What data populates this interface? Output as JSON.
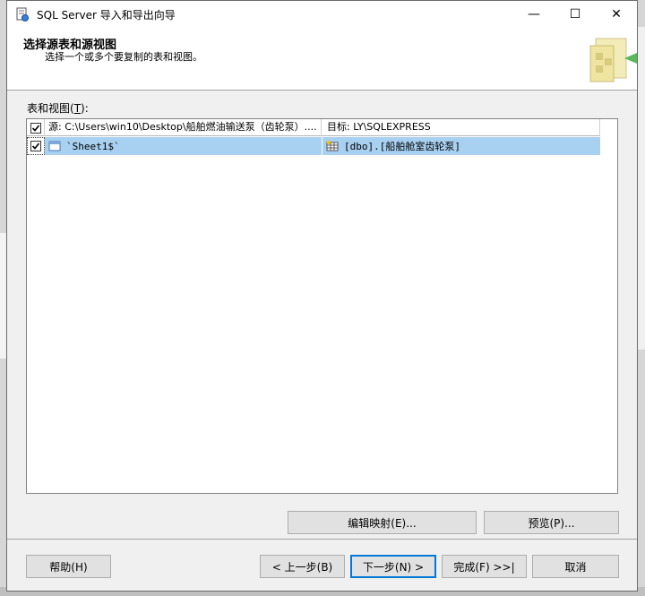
{
  "window": {
    "title": "SQL Server 导入和导出向导",
    "minimize": "—",
    "maximize": "☐",
    "close": "✕"
  },
  "header": {
    "title": "选择源表和源视图",
    "subtitle": "选择一个或多个要复制的表和视图。"
  },
  "tables_label": {
    "text": "表和视图(",
    "accel": "T",
    "suffix": "):"
  },
  "grid": {
    "columns": {
      "source": "源: C:\\Users\\win10\\Desktop\\船舶燃油输送泵（齿轮泵）....",
      "destination": "目标: LY\\SQLEXPRESS"
    },
    "header_checked": true,
    "rows": [
      {
        "checked": true,
        "source": "`Sheet1$`",
        "destination": "[dbo].[船舶舱室齿轮泵]"
      }
    ]
  },
  "buttons": {
    "edit_mappings": "编辑映射(E)...",
    "preview": "预览(P)...",
    "help": "帮助(H)",
    "back": "< 上一步(B)",
    "next": "下一步(N) >",
    "finish": "完成(F) >>|",
    "cancel": "取消"
  },
  "colors": {
    "selection": "#a8d0f0",
    "primary_border": "#0078d7"
  }
}
